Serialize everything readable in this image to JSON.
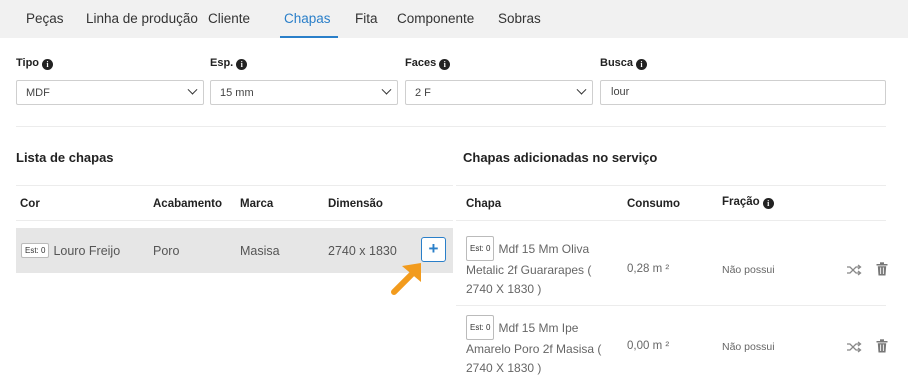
{
  "tabs": [
    "Peças",
    "Linha de produção",
    "Cliente",
    "Chapas",
    "Fita",
    "Componente",
    "Sobras"
  ],
  "active_tab": "Chapas",
  "filters": {
    "tipo_label": "Tipo",
    "tipo_value": "MDF",
    "esp_label": "Esp.",
    "esp_value": "15 mm",
    "faces_label": "Faces",
    "faces_value": "2 F",
    "busca_label": "Busca",
    "busca_value": "lour"
  },
  "lista": {
    "title": "Lista de chapas",
    "headers": [
      "Cor",
      "Acabamento",
      "Marca",
      "Dimensão"
    ],
    "row": {
      "badge": "Est: 0",
      "cor": "Louro Freijo",
      "acabamento": "Poro",
      "marca": "Masisa",
      "dimensao": "2740 x 1830",
      "add_label": "+"
    }
  },
  "adicionadas": {
    "title": "Chapas adicionadas no serviço",
    "headers": [
      "Chapa",
      "Consumo",
      "Fração"
    ],
    "rows": [
      {
        "badge": "Est: 0",
        "line1": "Mdf 15 Mm Oliva",
        "line2": "Metalic 2f Guararapes (",
        "line3": "2740 X 1830 )",
        "consumo": "0,28 m ²",
        "fracao": "Não possui"
      },
      {
        "badge": "Est: 0",
        "line1": "Mdf 15 Mm Ipe",
        "line2": "Amarelo Poro 2f Masisa (",
        "line3": "2740 X 1830 )",
        "consumo": "0,00 m ²",
        "fracao": "Não possui"
      }
    ]
  },
  "colors": {
    "accent": "#2a7fc9",
    "arrow": "#f29b1d",
    "tab_bar": "#f1f1f1",
    "row_highlight": "#e6e6e6"
  },
  "icons": [
    "info-icon",
    "chevron-down-icon",
    "plus-icon",
    "shuffle-icon",
    "trash-icon",
    "cursor-arrow-icon"
  ]
}
